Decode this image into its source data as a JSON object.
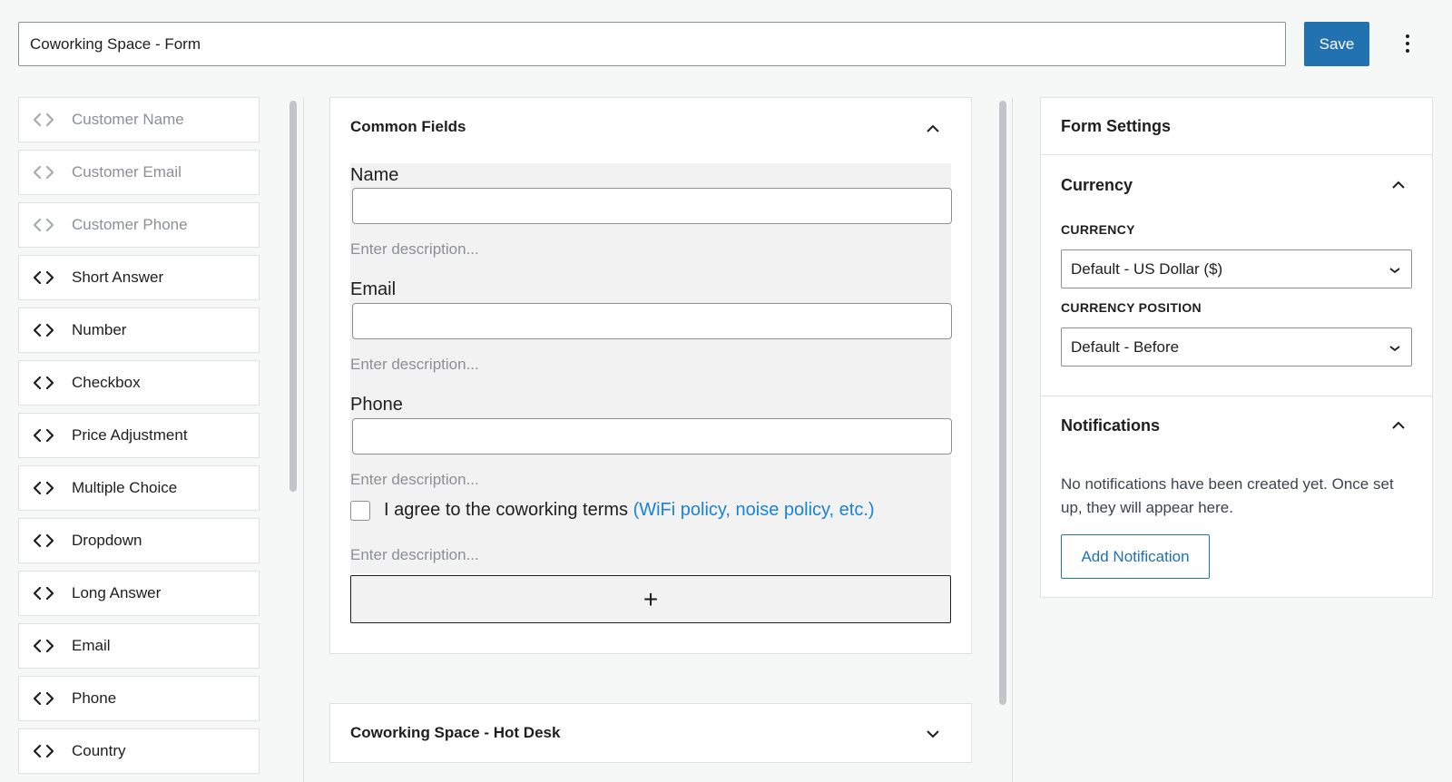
{
  "header": {
    "form_title": "Coworking Space - Form",
    "save_label": "Save",
    "more_icon": "more-vertical-icon"
  },
  "field_palette": [
    {
      "label": "Customer Name",
      "disabled": true
    },
    {
      "label": "Customer Email",
      "disabled": true
    },
    {
      "label": "Customer Phone",
      "disabled": true
    },
    {
      "label": "Short Answer",
      "disabled": false
    },
    {
      "label": "Number",
      "disabled": false
    },
    {
      "label": "Checkbox",
      "disabled": false
    },
    {
      "label": "Price Adjustment",
      "disabled": false
    },
    {
      "label": "Multiple Choice",
      "disabled": false
    },
    {
      "label": "Dropdown",
      "disabled": false
    },
    {
      "label": "Long Answer",
      "disabled": false
    },
    {
      "label": "Email",
      "disabled": false
    },
    {
      "label": "Phone",
      "disabled": false
    },
    {
      "label": "Country",
      "disabled": false
    }
  ],
  "common_fields": {
    "title": "Common Fields",
    "fields": [
      {
        "label": "Name",
        "description_placeholder": "Enter description..."
      },
      {
        "label": "Email",
        "description_placeholder": "Enter description..."
      },
      {
        "label": "Phone",
        "description_placeholder": "Enter description..."
      }
    ],
    "checkbox": {
      "text": "I agree to the coworking terms",
      "link_text": "(WiFi policy, noise policy, etc.)",
      "description_placeholder": "Enter description..."
    },
    "add_symbol": "+"
  },
  "second_section": {
    "title": "Coworking Space - Hot Desk"
  },
  "form_settings": {
    "title": "Form Settings",
    "currency_section": {
      "title": "Currency",
      "currency_label": "CURRENCY",
      "currency_value": "Default - US Dollar ($)",
      "position_label": "CURRENCY POSITION",
      "position_value": "Default - Before"
    },
    "notifications_section": {
      "title": "Notifications",
      "empty_text": "No notifications have been created yet. Once set up, they will appear here.",
      "add_label": "Add Notification"
    }
  },
  "colors": {
    "accent": "#2271b1",
    "link": "#1a82d6"
  }
}
